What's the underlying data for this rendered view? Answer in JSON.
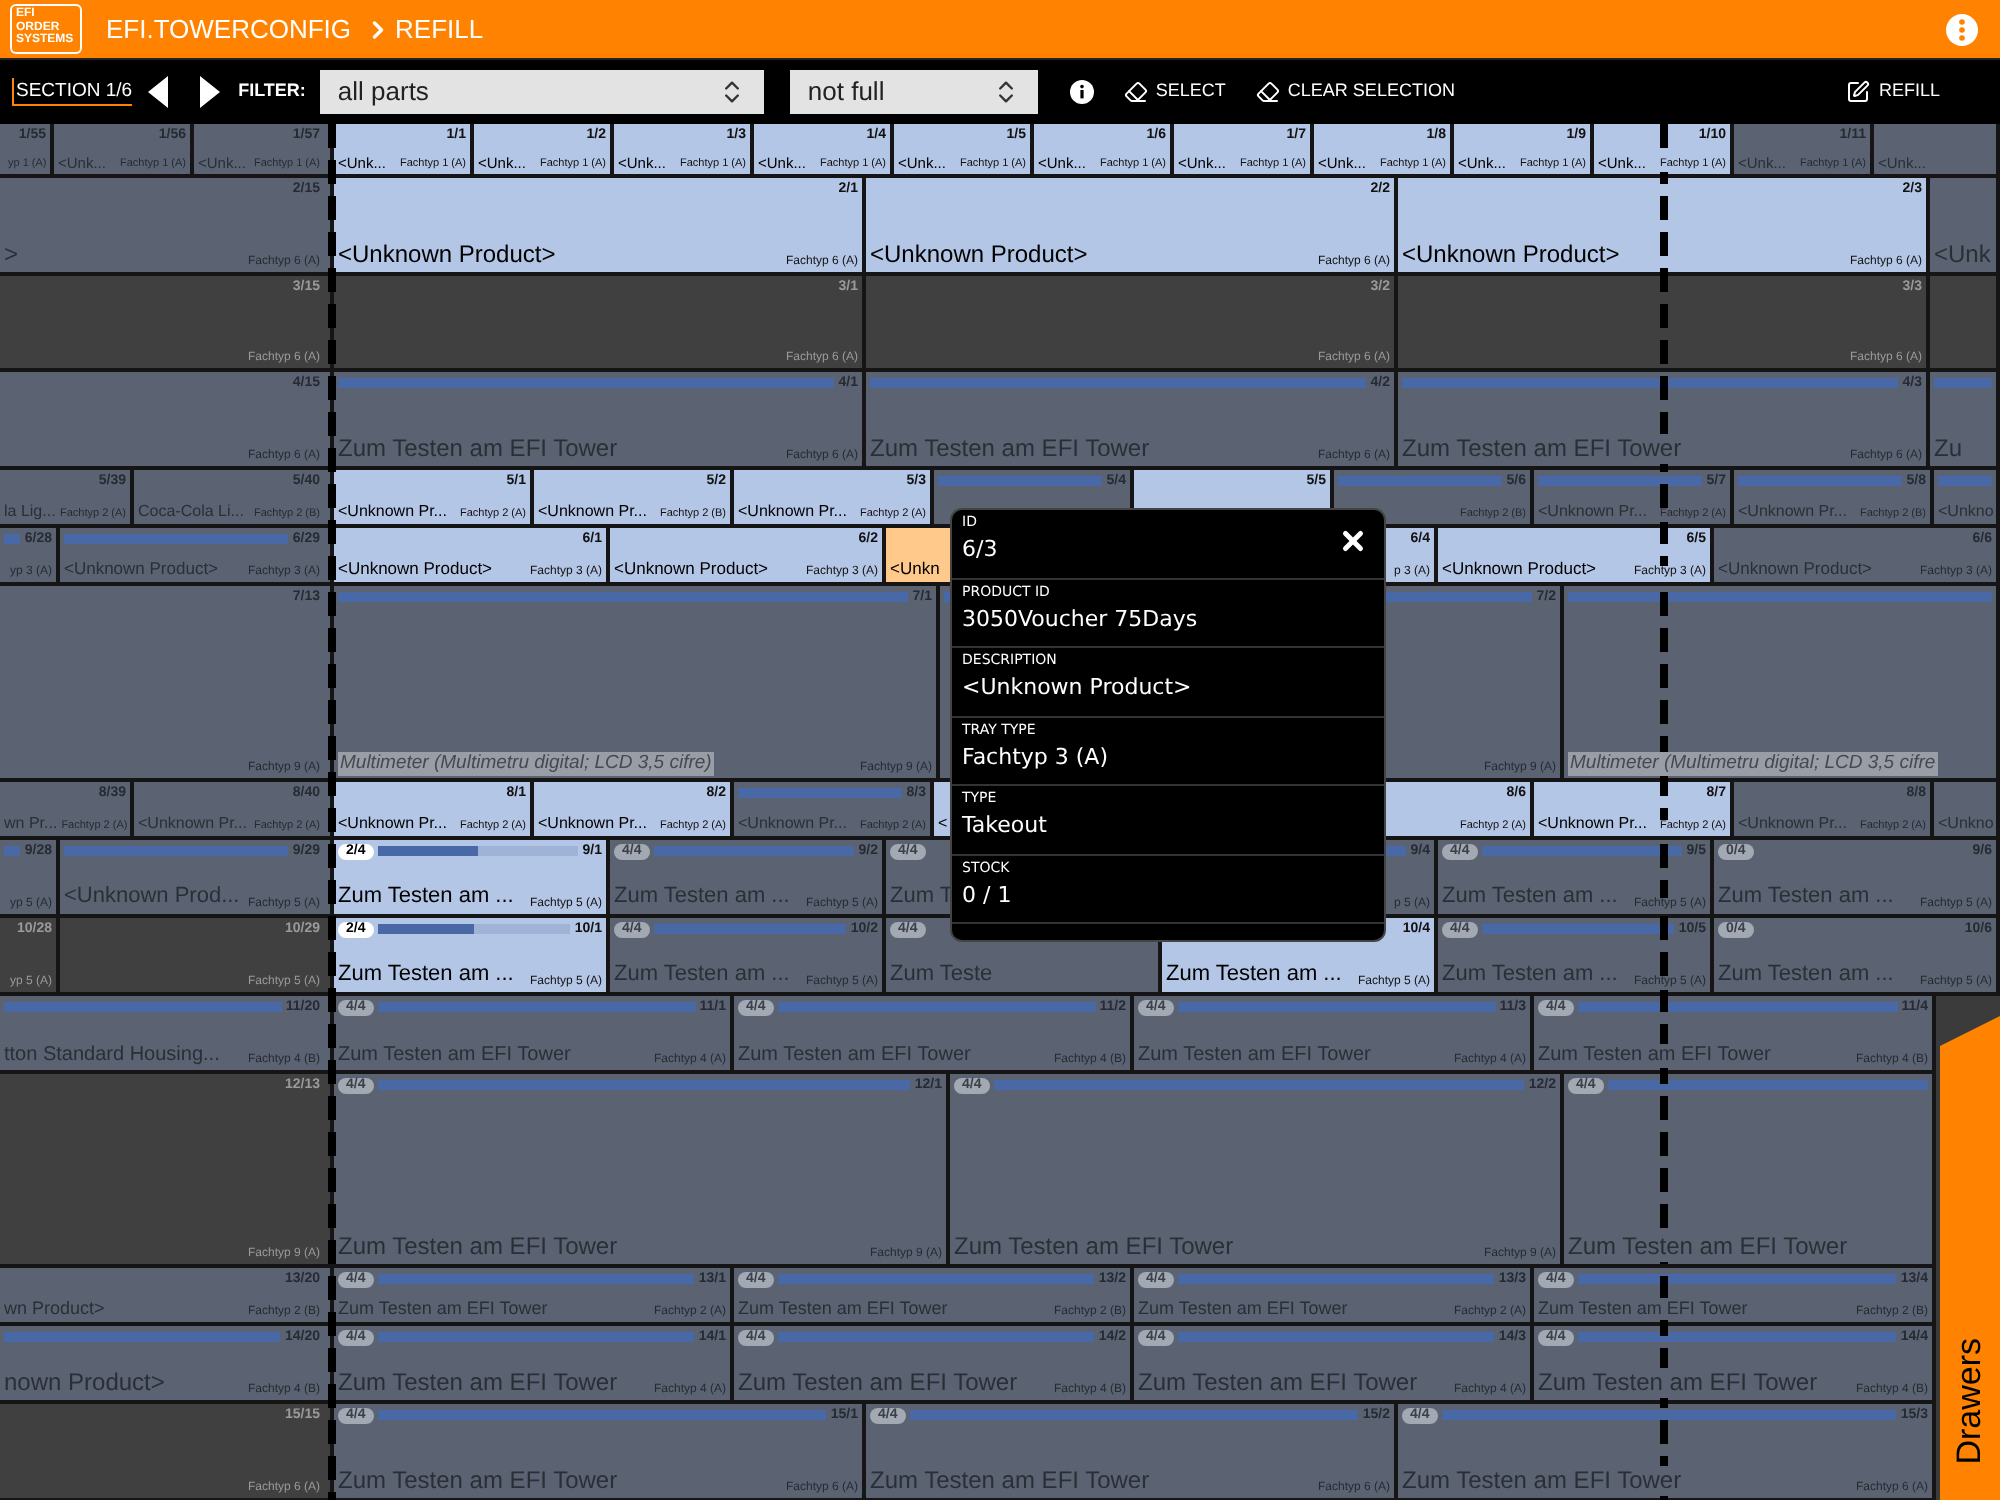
{
  "header": {
    "logo": "EFI ORDER SYSTEMS",
    "app": "EFI.TOWERCONFIG",
    "page": "REFILL"
  },
  "toolbar": {
    "section": "SECTION 1/6",
    "filter_label": "FILTER:",
    "parts_filter": {
      "value": "all parts"
    },
    "fill_filter": {
      "value": "not full"
    },
    "select": "SELECT",
    "clear": "CLEAR SELECTION",
    "refill": "REFILL"
  },
  "rows": [
    {
      "cells": [
        {
          "id": "1/55",
          "type": "yp 1 (A)",
          "kind": "other"
        },
        {
          "id": "1/56",
          "name": "<Unk...",
          "type": "Fachtyp 1 (A)",
          "kind": "other"
        },
        {
          "id": "1/57",
          "name": "<Unk...",
          "type": "Fachtyp 1 (A)",
          "kind": "other"
        },
        {
          "id": "1/1",
          "name": "<Unk...",
          "type": "Fachtyp 1 (A)",
          "kind": "match"
        },
        {
          "id": "1/2",
          "name": "<Unk...",
          "type": "Fachtyp 1 (A)",
          "kind": "match"
        },
        {
          "id": "1/3",
          "name": "<Unk...",
          "type": "Fachtyp 1 (A)",
          "kind": "match"
        },
        {
          "id": "1/4",
          "name": "<Unk...",
          "type": "Fachtyp 1 (A)",
          "kind": "match"
        },
        {
          "id": "1/5",
          "name": "<Unk...",
          "type": "Fachtyp 1 (A)",
          "kind": "match"
        },
        {
          "id": "1/6",
          "name": "<Unk...",
          "type": "Fachtyp 1 (A)",
          "kind": "match"
        },
        {
          "id": "1/7",
          "name": "<Unk...",
          "type": "Fachtyp 1 (A)",
          "kind": "match"
        },
        {
          "id": "1/8",
          "name": "<Unk...",
          "type": "Fachtyp 1 (A)",
          "kind": "match"
        },
        {
          "id": "1/9",
          "name": "<Unk...",
          "type": "Fachtyp 1 (A)",
          "kind": "match"
        },
        {
          "id": "1/10",
          "name": "<Unk...",
          "type": "Fachtyp 1 (A)",
          "kind": "match"
        },
        {
          "id": "1/11",
          "name": "<Unk...",
          "type": "Fachtyp 1 (A)",
          "kind": "other"
        },
        {
          "name": "<Unk...",
          "kind": "other"
        }
      ]
    },
    {
      "cells": [
        {
          "id": "2/15",
          "name": ">",
          "type": "Fachtyp 6 (A)",
          "kind": "other"
        },
        {
          "id": "2/1",
          "name": "<Unknown Product>",
          "type": "Fachtyp 6 (A)",
          "kind": "match"
        },
        {
          "id": "2/2",
          "name": "<Unknown Product>",
          "type": "Fachtyp 6 (A)",
          "kind": "match"
        },
        {
          "id": "2/3",
          "name": "<Unknown Product>",
          "type": "Fachtyp 6 (A)",
          "kind": "match"
        },
        {
          "name": "<Unk",
          "kind": "other"
        }
      ]
    },
    {
      "cells": [
        {
          "id": "3/15",
          "type": "Fachtyp 6 (A)",
          "kind": "empty"
        },
        {
          "id": "3/1",
          "type": "Fachtyp 6 (A)",
          "kind": "empty"
        },
        {
          "id": "3/2",
          "type": "Fachtyp 6 (A)",
          "kind": "empty"
        },
        {
          "id": "3/3",
          "type": "Fachtyp 6 (A)",
          "kind": "empty"
        },
        {
          "kind": "empty"
        }
      ]
    },
    {
      "cells": [
        {
          "id": "4/15",
          "type": "Fachtyp 6 (A)",
          "kind": "other"
        },
        {
          "id": "4/1",
          "name": "Zum Testen am EFI Tower",
          "type": "Fachtyp 6 (A)",
          "kind": "other",
          "level": 1
        },
        {
          "id": "4/2",
          "name": "Zum Testen am EFI Tower",
          "type": "Fachtyp 6 (A)",
          "kind": "other",
          "level": 1
        },
        {
          "id": "4/3",
          "name": "Zum Testen am EFI Tower",
          "type": "Fachtyp 6 (A)",
          "kind": "other",
          "level": 1
        },
        {
          "name": "Zu",
          "kind": "other",
          "level": 1
        }
      ]
    },
    {
      "cells": [
        {
          "id": "5/39",
          "name": "la Lig...",
          "type": "Fachtyp 2 (A)",
          "kind": "other"
        },
        {
          "id": "5/40",
          "name": "Coca-Cola Li...",
          "type": "Fachtyp 2 (B)",
          "kind": "other"
        },
        {
          "id": "5/1",
          "name": "<Unknown Pr...",
          "type": "Fachtyp 2 (A)",
          "kind": "match"
        },
        {
          "id": "5/2",
          "name": "<Unknown Pr...",
          "type": "Fachtyp 2 (B)",
          "kind": "match"
        },
        {
          "id": "5/3",
          "name": "<Unknown Pr...",
          "type": "Fachtyp 2 (A)",
          "kind": "match"
        },
        {
          "id": "5/4",
          "kind": "other",
          "level": 1
        },
        {
          "id": "5/5",
          "kind": "match"
        },
        {
          "id": "5/6",
          "type": "Fachtyp 2 (B)",
          "kind": "other",
          "level": 1
        },
        {
          "id": "5/7",
          "name": "<Unknown Pr...",
          "type": "Fachtyp 2 (A)",
          "kind": "other",
          "level": 1
        },
        {
          "id": "5/8",
          "name": "<Unknown Pr...",
          "type": "Fachtyp 2 (B)",
          "kind": "other",
          "level": 1
        },
        {
          "name": "<Unkno",
          "kind": "other",
          "level": 1
        }
      ]
    },
    {
      "cells": [
        {
          "id": "6/28",
          "type": "yp 3 (A)",
          "kind": "other",
          "level": 1
        },
        {
          "id": "6/29",
          "name": "<Unknown Product>",
          "type": "Fachtyp 3 (A)",
          "kind": "other",
          "level": 1
        },
        {
          "id": "6/1",
          "name": "<Unknown Product>",
          "type": "Fachtyp 3 (A)",
          "kind": "match"
        },
        {
          "id": "6/2",
          "name": "<Unknown Product>",
          "type": "Fachtyp 3 (A)",
          "kind": "match"
        },
        {
          "name": "<Unkn",
          "kind": "selected"
        },
        {
          "id": "6/4",
          "type": "p 3 (A)",
          "kind": "match"
        },
        {
          "id": "6/5",
          "name": "<Unknown Product>",
          "type": "Fachtyp 3 (A)",
          "kind": "match"
        },
        {
          "id": "6/6",
          "name": "<Unknown Product>",
          "type": "Fachtyp 3 (A)",
          "kind": "other"
        }
      ]
    },
    {
      "cells": [
        {
          "id": "7/13",
          "type": "Fachtyp 9 (A)",
          "kind": "other"
        },
        {
          "id": "7/1",
          "name": "Multimeter (Multimetru digital; LCD 3,5 cifre)",
          "type": "Fachtyp 9 (A)",
          "kind": "other",
          "level": 1,
          "marked": true
        },
        {
          "id": "7/2",
          "type": "Fachtyp 9 (A)",
          "kind": "other",
          "level": 1
        },
        {
          "name": "Multimeter (Multimetru digital; LCD 3,5 cifre",
          "kind": "other",
          "level": 1,
          "marked": true
        }
      ]
    },
    {
      "cells": [
        {
          "id": "8/39",
          "name": "wn Pr...",
          "type": "Fachtyp 2 (A)",
          "kind": "other"
        },
        {
          "id": "8/40",
          "name": "<Unknown Pr...",
          "type": "Fachtyp 2 (A)",
          "kind": "other"
        },
        {
          "id": "8/1",
          "name": "<Unknown Pr...",
          "type": "Fachtyp 2 (A)",
          "kind": "match"
        },
        {
          "id": "8/2",
          "name": "<Unknown Pr...",
          "type": "Fachtyp 2 (A)",
          "kind": "match"
        },
        {
          "id": "8/3",
          "name": "<Unknown Pr...",
          "type": "Fachtyp 2 (A)",
          "kind": "other",
          "level": 1
        },
        {
          "name": "<",
          "kind": "match"
        },
        {
          "id": "8/6",
          "type": "Fachtyp 2 (A)",
          "kind": "match"
        },
        {
          "id": "8/7",
          "name": "<Unknown Pr...",
          "type": "Fachtyp 2 (A)",
          "kind": "match"
        },
        {
          "id": "8/8",
          "name": "<Unknown Pr...",
          "type": "Fachtyp 2 (A)",
          "kind": "other"
        },
        {
          "name": "<Unkno",
          "kind": "other"
        }
      ]
    },
    {
      "cells": [
        {
          "id": "9/28",
          "type": "yp 5 (A)",
          "kind": "other",
          "level": 1
        },
        {
          "id": "9/29",
          "name": "<Unknown Prod...",
          "type": "Fachtyp 5 (A)",
          "kind": "other",
          "level": 1
        },
        {
          "id": "9/1",
          "stock": "2/4",
          "name": "Zum Testen am ...",
          "type": "Fachtyp 5 (A)",
          "kind": "match",
          "level": 0.5
        },
        {
          "id": "9/2",
          "stock": "4/4",
          "name": "Zum Testen am ...",
          "type": "Fachtyp 5 (A)",
          "kind": "other",
          "level": 1
        },
        {
          "stock": "4/4",
          "name": "Zum T",
          "kind": "other"
        },
        {
          "id": "9/4",
          "type": "p 5 (A)",
          "kind": "other",
          "level": 1
        },
        {
          "id": "9/5",
          "stock": "4/4",
          "name": "Zum Testen am ...",
          "type": "Fachtyp 5 (A)",
          "kind": "other",
          "level": 1
        },
        {
          "id": "9/6",
          "stock": "0/4",
          "name": "Zum Testen am ...",
          "type": "Fachtyp 5 (A)",
          "kind": "other"
        }
      ]
    },
    {
      "cells": [
        {
          "id": "10/28",
          "type": "yp 5 (A)",
          "kind": "empty"
        },
        {
          "id": "10/29",
          "type": "Fachtyp 5 (A)",
          "kind": "empty"
        },
        {
          "id": "10/1",
          "stock": "2/4",
          "name": "Zum Testen am ...",
          "type": "Fachtyp 5 (A)",
          "kind": "match",
          "level": 0.5
        },
        {
          "id": "10/2",
          "stock": "4/4",
          "name": "Zum Testen am ...",
          "type": "Fachtyp 5 (A)",
          "kind": "other",
          "level": 1
        },
        {
          "stock": "4/4",
          "name": "Zum Teste",
          "kind": "other"
        },
        {
          "id": "10/4",
          "name": "Zum Testen am ...",
          "type": "Fachtyp 5 (A)",
          "kind": "match"
        },
        {
          "id": "10/5",
          "stock": "4/4",
          "name": "Zum Testen am ...",
          "type": "Fachtyp 5 (A)",
          "kind": "other",
          "level": 1
        },
        {
          "id": "10/6",
          "stock": "0/4",
          "name": "Zum Testen am ...",
          "type": "Fachtyp 5 (A)",
          "kind": "other"
        }
      ]
    },
    {
      "cells": [
        {
          "id": "11/20",
          "name": "tton Standard Housing...",
          "type": "Fachtyp 4 (B)",
          "kind": "other",
          "level": 1
        },
        {
          "id": "11/1",
          "stock": "4/4",
          "name": "Zum Testen am EFI Tower",
          "type": "Fachtyp 4 (A)",
          "kind": "other",
          "level": 1
        },
        {
          "id": "11/2",
          "stock": "4/4",
          "name": "Zum Testen am EFI Tower",
          "type": "Fachtyp 4 (B)",
          "kind": "other",
          "level": 1
        },
        {
          "id": "11/3",
          "stock": "4/4",
          "name": "Zum Testen am EFI Tower",
          "type": "Fachtyp 4 (A)",
          "kind": "other",
          "level": 1
        },
        {
          "id": "11/4",
          "stock": "4/4",
          "name": "Zum Testen am EFI Tower",
          "type": "Fachtyp 4 (B)",
          "kind": "other",
          "level": 1
        }
      ]
    },
    {
      "cells": [
        {
          "id": "12/13",
          "type": "Fachtyp 9 (A)",
          "kind": "empty"
        },
        {
          "id": "12/1",
          "stock": "4/4",
          "name": "Zum Testen am EFI Tower",
          "type": "Fachtyp 9 (A)",
          "kind": "other",
          "level": 1
        },
        {
          "id": "12/2",
          "stock": "4/4",
          "name": "Zum Testen am EFI Tower",
          "type": "Fachtyp 9 (A)",
          "kind": "other",
          "level": 1
        },
        {
          "stock": "4/4",
          "name": "Zum Testen am EFI Tower",
          "kind": "other",
          "level": 1
        }
      ]
    },
    {
      "cells": [
        {
          "id": "13/20",
          "name": "wn Product>",
          "type": "Fachtyp 2 (B)",
          "kind": "other"
        },
        {
          "id": "13/1",
          "stock": "4/4",
          "name": "Zum Testen am EFI Tower",
          "type": "Fachtyp 2 (A)",
          "kind": "other",
          "level": 1
        },
        {
          "id": "13/2",
          "stock": "4/4",
          "name": "Zum Testen am EFI Tower",
          "type": "Fachtyp 2 (B)",
          "kind": "other",
          "level": 1
        },
        {
          "id": "13/3",
          "stock": "4/4",
          "name": "Zum Testen am EFI Tower",
          "type": "Fachtyp 2 (A)",
          "kind": "other",
          "level": 1
        },
        {
          "id": "13/4",
          "stock": "4/4",
          "name": "Zum Testen am EFI Tower",
          "type": "Fachtyp 2 (B)",
          "kind": "other",
          "level": 1
        }
      ]
    },
    {
      "cells": [
        {
          "id": "14/20",
          "name": "nown Product>",
          "type": "Fachtyp 4 (B)",
          "kind": "other",
          "level": 1
        },
        {
          "id": "14/1",
          "stock": "4/4",
          "name": "Zum Testen am EFI Tower",
          "type": "Fachtyp 4 (A)",
          "kind": "other",
          "level": 1
        },
        {
          "id": "14/2",
          "stock": "4/4",
          "name": "Zum Testen am EFI Tower",
          "type": "Fachtyp 4 (B)",
          "kind": "other",
          "level": 1
        },
        {
          "id": "14/3",
          "stock": "4/4",
          "name": "Zum Testen am EFI Tower",
          "type": "Fachtyp 4 (A)",
          "kind": "other",
          "level": 1
        },
        {
          "id": "14/4",
          "stock": "4/4",
          "name": "Zum Testen am EFI Tower",
          "type": "Fachtyp 4 (B)",
          "kind": "other",
          "level": 1
        }
      ]
    },
    {
      "cells": [
        {
          "id": "15/15",
          "type": "Fachtyp 6 (A)",
          "kind": "empty"
        },
        {
          "id": "15/1",
          "stock": "4/4",
          "name": "Zum Testen am EFI Tower",
          "type": "Fachtyp 6 (A)",
          "kind": "other",
          "level": 1
        },
        {
          "id": "15/2",
          "stock": "4/4",
          "name": "Zum Testen am EFI Tower",
          "type": "Fachtyp 6 (A)",
          "kind": "other",
          "level": 1
        },
        {
          "id": "15/3",
          "stock": "4/4",
          "name": "Zum Testen am EFI Tower",
          "type": "Fachtyp 6 (A)",
          "kind": "other",
          "level": 1
        }
      ]
    }
  ],
  "details": {
    "fields": [
      {
        "label": "ID",
        "value": "6/3"
      },
      {
        "label": "PRODUCT ID",
        "value": "3050Voucher 75Days"
      },
      {
        "label": "DESCRIPTION",
        "value": "<Unknown Product>"
      },
      {
        "label": "TRAY TYPE",
        "value": "Fachtyp 3 (A)"
      },
      {
        "label": "TYPE",
        "value": "Takeout"
      },
      {
        "label": "STOCK",
        "value": "0 / 1"
      }
    ]
  },
  "drawers_tab": "Drawers"
}
